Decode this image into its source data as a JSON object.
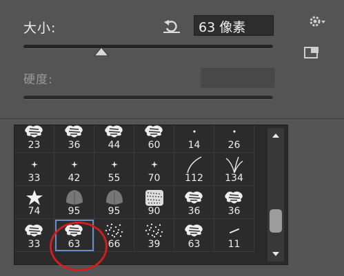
{
  "panel": {
    "size_label": "大小:",
    "size_value": "63 像素",
    "hardness_label": "硬度:"
  },
  "brushes": [
    {
      "size": "23",
      "kind": "splatter"
    },
    {
      "size": "36",
      "kind": "splatter"
    },
    {
      "size": "44",
      "kind": "splatter"
    },
    {
      "size": "60",
      "kind": "splatter"
    },
    {
      "size": "14",
      "kind": "dot"
    },
    {
      "size": "26",
      "kind": "dot"
    },
    {
      "size": "33",
      "kind": "star"
    },
    {
      "size": "42",
      "kind": "star"
    },
    {
      "size": "55",
      "kind": "star"
    },
    {
      "size": "70",
      "kind": "star"
    },
    {
      "size": "112",
      "kind": "grass"
    },
    {
      "size": "134",
      "kind": "grass2"
    },
    {
      "size": "74",
      "kind": "leaf-star"
    },
    {
      "size": "95",
      "kind": "leaf"
    },
    {
      "size": "95",
      "kind": "leaf"
    },
    {
      "size": "90",
      "kind": "texture"
    },
    {
      "size": "36",
      "kind": "splatter"
    },
    {
      "size": "36",
      "kind": "splatter"
    },
    {
      "size": "33",
      "kind": "splatter"
    },
    {
      "size": "63",
      "kind": "splatter",
      "selected": true
    },
    {
      "size": "66",
      "kind": "speckle"
    },
    {
      "size": "39",
      "kind": "speckle"
    },
    {
      "size": "63",
      "kind": "splatter"
    },
    {
      "size": "11",
      "kind": "streak"
    }
  ],
  "colors": {
    "selection": "#6a8fc8",
    "highlight_circle": "#d21e1e"
  },
  "icons": [
    "reset-icon",
    "gear-icon",
    "new-preset-icon",
    "scroll-up-icon",
    "scroll-down-icon"
  ]
}
